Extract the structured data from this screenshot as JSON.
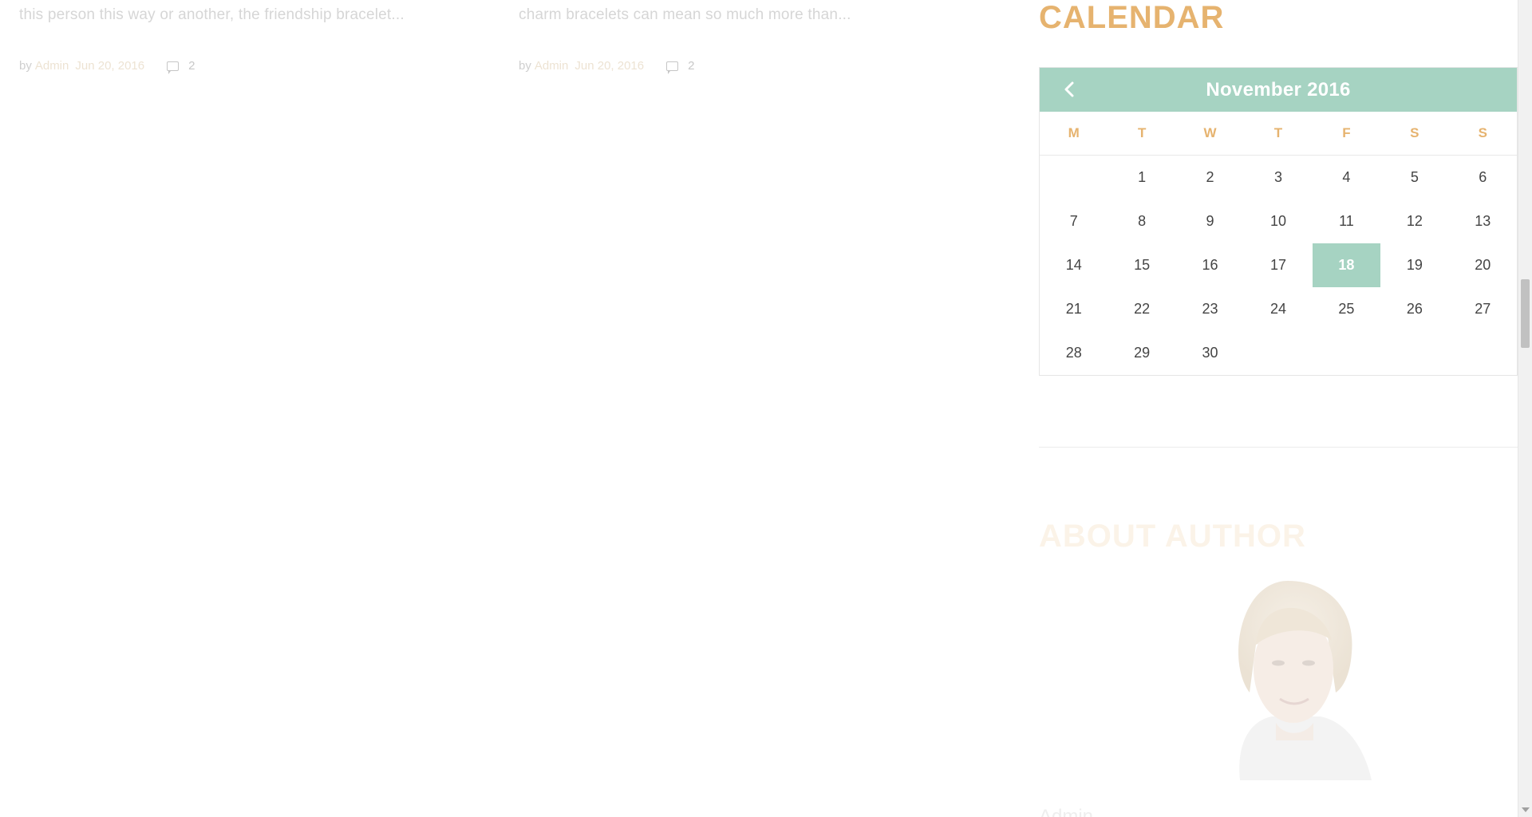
{
  "posts": [
    {
      "excerpt": "this person this way or another, the friendship bracelet...",
      "by": "by",
      "author": "Admin",
      "date": "Jun 20, 2016",
      "comments": "2"
    },
    {
      "excerpt": "charm bracelets can mean so much more than...",
      "by": "by",
      "author": "Admin",
      "date": "Jun 20, 2016",
      "comments": "2"
    }
  ],
  "sidebar": {
    "calendar_title": "CALENDAR",
    "calendar": {
      "month_label": "November 2016",
      "prev_icon": "chevron-left-icon",
      "weekdays": [
        "M",
        "T",
        "W",
        "T",
        "F",
        "S",
        "S"
      ],
      "leading_blanks": 1,
      "days_in_month": 30,
      "selected_day": 18
    },
    "about_title": "ABOUT AUTHOR",
    "author_name": "Admin"
  },
  "colors": {
    "accent_gold": "#e6b36f",
    "accent_mint": "#a6d3c2",
    "text": "#444444"
  }
}
